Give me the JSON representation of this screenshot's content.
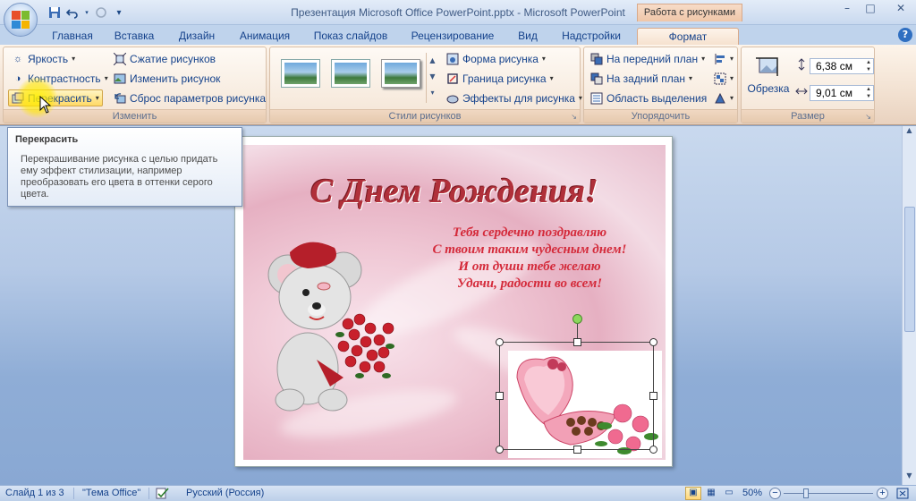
{
  "window": {
    "title": "Презентация Microsoft Office PowerPoint.pptx - Microsoft PowerPoint",
    "context_tab_header": "Работа с рисунками",
    "controls": {
      "minimize": "–",
      "restore": "□",
      "close": "✕"
    }
  },
  "qat": {
    "save_icon": "save-icon",
    "undo_icon": "undo-icon",
    "redo_icon": "redo-icon",
    "customize_icon": "customize-icon"
  },
  "tabs": [
    {
      "label": "Главная"
    },
    {
      "label": "Вставка"
    },
    {
      "label": "Дизайн"
    },
    {
      "label": "Анимация"
    },
    {
      "label": "Показ слайдов"
    },
    {
      "label": "Рецензирование"
    },
    {
      "label": "Вид"
    },
    {
      "label": "Надстройки"
    },
    {
      "label": "Формат",
      "active": true
    }
  ],
  "ribbon": {
    "adjust": {
      "label": "Изменить",
      "brightness": "Яркость",
      "contrast": "Контрастность",
      "recolor": "Перекрасить",
      "compress": "Сжатие рисунков",
      "change": "Изменить рисунок",
      "reset": "Сброс параметров рисунка"
    },
    "styles": {
      "label": "Стили рисунков",
      "shape": "Форма рисунка",
      "border": "Граница рисунка",
      "effects": "Эффекты для рисунка"
    },
    "arrange": {
      "label": "Упорядочить",
      "front": "На передний план",
      "back": "На задний план",
      "selection": "Область выделения"
    },
    "size": {
      "label": "Размер",
      "crop": "Обрезка",
      "height": "6,38 см",
      "width": "9,01 см"
    }
  },
  "tooltip": {
    "title": "Перекрасить",
    "body": "Перекрашивание рисунка с целью придать ему эффект стилизации, например преобразовать его цвета в оттенки серого цвета."
  },
  "slide": {
    "title": "С Днем Рождения!",
    "poem": [
      "Тебя сердечно поздравляю",
      "С твоим таким чудесным днем!",
      "И от души тебе желаю",
      "Удачи, радости во всем!"
    ]
  },
  "statusbar": {
    "slide": "Слайд 1 из 3",
    "theme": "\"Тема Office\"",
    "language": "Русский (Россия)",
    "zoom": "50%"
  },
  "colors": {
    "accent": "#15428b",
    "title_red": "#b0303a",
    "poem_red": "#d42a3a",
    "context_tab": "#efc6a8"
  }
}
